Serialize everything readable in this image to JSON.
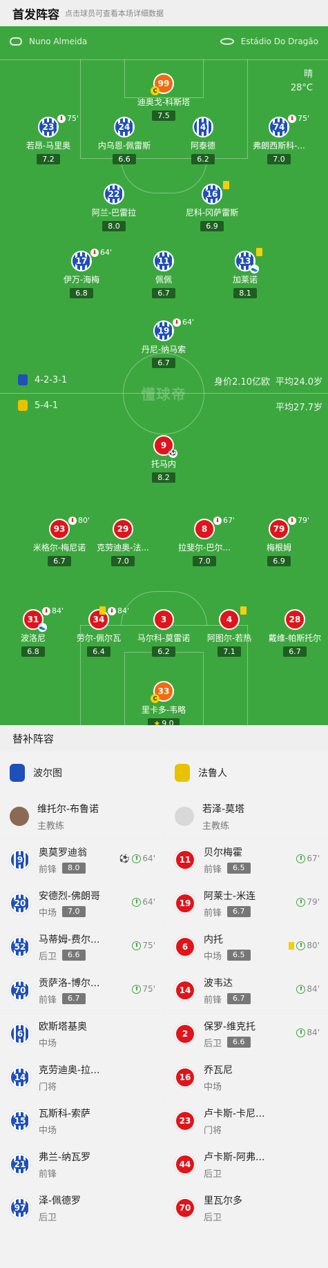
{
  "header": {
    "title": "首发阵容",
    "hint": "点击球员可查看本场详细数据"
  },
  "pitch": {
    "referee": "Nuno Almeida",
    "venue": "Estádio Do Dragão",
    "weather": "晴",
    "temperature": "28°C",
    "watermark": "懂球帝",
    "home": {
      "formation": "4-2-3-1",
      "value": "身价2.10亿欧",
      "avg_age": "平均24.0岁",
      "color": "#1f4fb8"
    },
    "away": {
      "formation": "5-4-1",
      "avg_age": "平均27.7岁",
      "color": "#e1141b"
    }
  },
  "home_players": [
    {
      "number": "99",
      "name": "迪奥戈-科斯塔",
      "rating": "7.5",
      "kit": "gk",
      "captain": true
    },
    {
      "number": "23",
      "name": "若昂-马里奥",
      "rating": "7.2",
      "kit": "porto",
      "sub_out": "75'"
    },
    {
      "number": "24",
      "name": "内乌恩-佩雷斯",
      "rating": "6.6",
      "kit": "porto"
    },
    {
      "number": "4",
      "name": "阿泰德",
      "rating": "6.2",
      "kit": "porto"
    },
    {
      "number": "74",
      "name": "弗朗西斯科-...",
      "rating": "7.0",
      "kit": "porto",
      "sub_out": "75'"
    },
    {
      "number": "22",
      "name": "阿兰-巴雷拉",
      "rating": "8.0",
      "kit": "porto"
    },
    {
      "number": "16",
      "name": "尼科-冈萨雷斯",
      "rating": "6.9",
      "kit": "porto",
      "yellow": true
    },
    {
      "number": "17",
      "name": "伊万-海梅",
      "rating": "6.8",
      "kit": "porto",
      "sub_out": "64'"
    },
    {
      "number": "11",
      "name": "佩佩",
      "rating": "6.7",
      "kit": "porto"
    },
    {
      "number": "13",
      "name": "加莱诺",
      "rating": "8.1",
      "kit": "porto",
      "yellow": true,
      "assist": true
    },
    {
      "number": "19",
      "name": "丹尼-纳马索",
      "rating": "6.7",
      "kit": "porto",
      "sub_out": "64'"
    }
  ],
  "away_players": [
    {
      "number": "9",
      "name": "托马内",
      "rating": "8.2",
      "kit": "fama",
      "goal": true
    },
    {
      "number": "93",
      "name": "米格尔-梅尼诺",
      "rating": "6.7",
      "kit": "fama",
      "sub_out": "80'"
    },
    {
      "number": "29",
      "name": "克劳迪奥-法...",
      "rating": "7.0",
      "kit": "fama"
    },
    {
      "number": "8",
      "name": "拉斐尔-巴尔...",
      "rating": "7.0",
      "kit": "fama",
      "sub_out": "67'"
    },
    {
      "number": "79",
      "name": "梅根姆",
      "rating": "6.9",
      "kit": "fama",
      "sub_out": "79'"
    },
    {
      "number": "31",
      "name": "波洛尼",
      "rating": "6.8",
      "kit": "fama",
      "sub_out": "84'",
      "assist": true
    },
    {
      "number": "34",
      "name": "劳尔-佩尔瓦",
      "rating": "6.4",
      "kit": "fama",
      "yellow": true,
      "sub_out": "84'"
    },
    {
      "number": "3",
      "name": "马尔科-莫雷诺",
      "rating": "6.2",
      "kit": "fama"
    },
    {
      "number": "4",
      "name": "阿图尔-若热",
      "rating": "7.1",
      "kit": "fama",
      "yellow": true
    },
    {
      "number": "28",
      "name": "戴维-帕斯托尔",
      "rating": "6.7",
      "kit": "fama"
    },
    {
      "number": "33",
      "name": "里卡多-韦略",
      "rating": "9.0",
      "kit": "gk",
      "captain": true,
      "best": true
    }
  ],
  "subs": {
    "title": "替补阵容",
    "home": {
      "team": "波尔图",
      "coach": {
        "name": "维托尔-布鲁诺",
        "role": "主教练"
      },
      "players": [
        {
          "number": "9",
          "name": "奥莫罗迪翁",
          "pos": "前锋",
          "rating": "8.0",
          "in": "64'",
          "goal": true
        },
        {
          "number": "20",
          "name": "安德烈-佛朗哥",
          "pos": "中场",
          "rating": "7.0",
          "in": "64'"
        },
        {
          "number": "52",
          "name": "马蒂姆-费尔...",
          "pos": "后卫",
          "rating": "6.6",
          "in": "75'"
        },
        {
          "number": "70",
          "name": "贡萨洛-博尔...",
          "pos": "前锋",
          "rating": "6.7",
          "in": "75'"
        },
        {
          "number": "6",
          "name": "欧斯塔基奥",
          "pos": "中场"
        },
        {
          "number": "14",
          "name": "克劳迪奥-拉...",
          "pos": "门将"
        },
        {
          "number": "15",
          "name": "瓦斯科-索萨",
          "pos": "中场"
        },
        {
          "number": "21",
          "name": "弗兰-纳瓦罗",
          "pos": "前锋"
        },
        {
          "number": "97",
          "name": "泽-佩德罗",
          "pos": "后卫"
        }
      ]
    },
    "away": {
      "team": "法鲁人",
      "coach": {
        "name": "若泽-莫塔",
        "role": "主教练"
      },
      "players": [
        {
          "number": "11",
          "name": "贝尔梅霍",
          "pos": "前锋",
          "rating": "6.5",
          "in": "67'"
        },
        {
          "number": "19",
          "name": "阿莱士-米连",
          "pos": "前锋",
          "rating": "6.7",
          "in": "79'"
        },
        {
          "number": "6",
          "name": "内托",
          "pos": "中场",
          "rating": "6.5",
          "in": "80'",
          "yellow": true
        },
        {
          "number": "14",
          "name": "波韦达",
          "pos": "前锋",
          "rating": "6.7",
          "in": "84'"
        },
        {
          "number": "2",
          "name": "保罗-维克托",
          "pos": "后卫",
          "rating": "6.6",
          "in": "84'"
        },
        {
          "number": "16",
          "name": "乔瓦尼",
          "pos": "中场"
        },
        {
          "number": "23",
          "name": "卢卡斯-卡尼...",
          "pos": "门将"
        },
        {
          "number": "44",
          "name": "卢卡斯-阿弗...",
          "pos": "后卫"
        },
        {
          "number": "70",
          "name": "里瓦尔多",
          "pos": "后卫"
        }
      ]
    }
  }
}
